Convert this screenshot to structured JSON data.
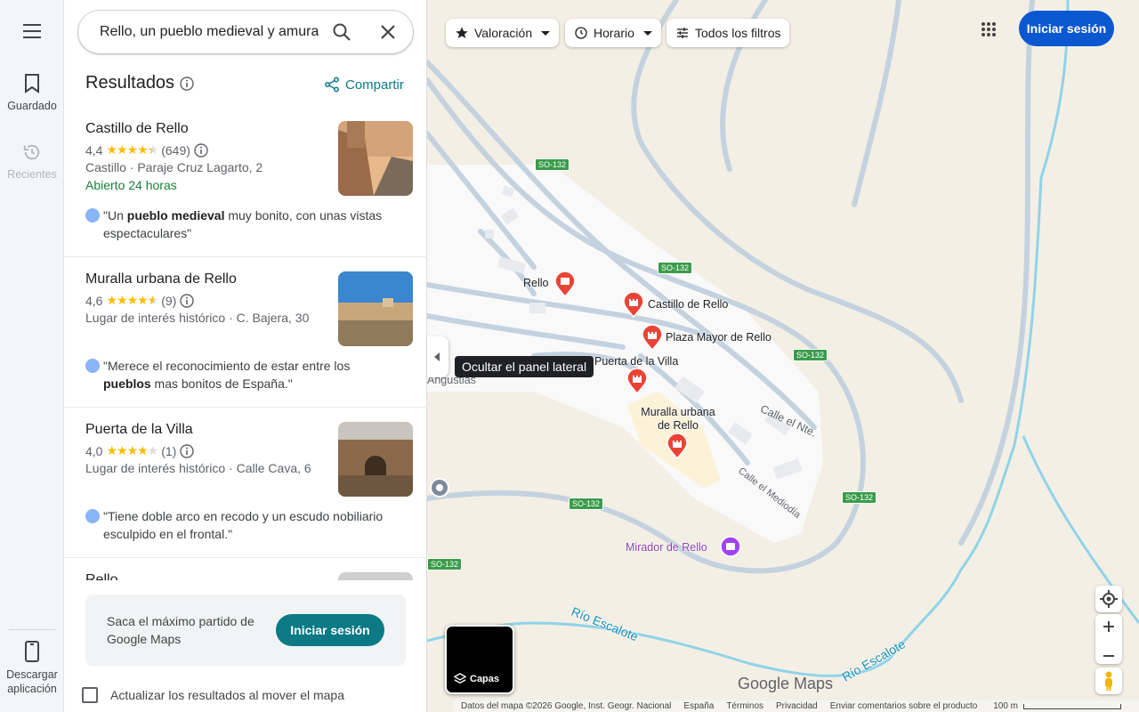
{
  "rail": {
    "saved_label": "Guardado",
    "recent_label": "Recientes",
    "download_label": "Descargar aplicación"
  },
  "search": {
    "value": "Rello, un pueblo medieval y amurallado"
  },
  "results": {
    "heading": "Resultados",
    "share_label": "Compartir",
    "items": [
      {
        "name": "Castillo de Rello",
        "rating": "4,4",
        "stars": 4.4,
        "count": "(649)",
        "meta": "Castillo · Paraje Cruz Lagarto, 2",
        "status": "Abierto 24 horas",
        "review_pre": "\"Un ",
        "review_bold": "pueblo medieval",
        "review_post": " muy bonito, con unas vistas espectaculares\""
      },
      {
        "name": "Muralla urbana de Rello",
        "rating": "4,6",
        "stars": 4.6,
        "count": "(9)",
        "meta": "Lugar de interés histórico · C. Bajera, 30",
        "review_pre": "\"Merece el reconocimiento de estar entre los ",
        "review_bold": "pueblos",
        "review_post": " mas bonitos de España.\""
      },
      {
        "name": "Puerta de la Villa",
        "rating": "4,0",
        "stars": 4.0,
        "count": "(1)",
        "meta": "Lugar de interés histórico · Calle Cava, 6",
        "review_pre": "\"Tiene doble arco en recodo y un escudo nobiliario esculpido en el frontal.\"",
        "review_bold": "",
        "review_post": ""
      },
      {
        "name": "Rello"
      }
    ]
  },
  "promo": {
    "text": "Saca el máximo partido de Google Maps",
    "button": "Iniciar sesión"
  },
  "update_checkbox_label": "Actualizar los resultados al mover el mapa",
  "tooltip": "Ocultar el panel lateral",
  "filters": {
    "rating": "Valoración",
    "hours": "Horario",
    "all": "Todos los filtros"
  },
  "top_signin": "Iniciar sesión",
  "map": {
    "places": {
      "rello": "Rello",
      "castillo": "Castillo de Rello",
      "plaza": "Plaza Mayor de Rello",
      "puerta": "Puerta de la Villa",
      "muralla": "Muralla urbana de Rello",
      "mirador": "Mirador de Rello",
      "angustias": "Angustias",
      "calle_nte": "Calle el Nte.",
      "calle_mediodia": "Calle el Mediodía",
      "rio1": "Río Escalote",
      "rio2": "Río Escalote"
    },
    "road": "SO-132",
    "layers_label": "Capas",
    "logo": "Google Maps"
  },
  "footer": {
    "data": "Datos del mapa ©2026 Google, Inst. Geogr. Nacional",
    "country": "España",
    "terms": "Términos",
    "privacy": "Privacidad",
    "feedback": "Enviar comentarios sobre el producto",
    "scale": "100 m"
  },
  "colors": {
    "accent": "#0b7a85",
    "signin_blue": "#0b57d0",
    "pin_red": "#ea4335",
    "mirador_purple": "#8e44ad"
  }
}
